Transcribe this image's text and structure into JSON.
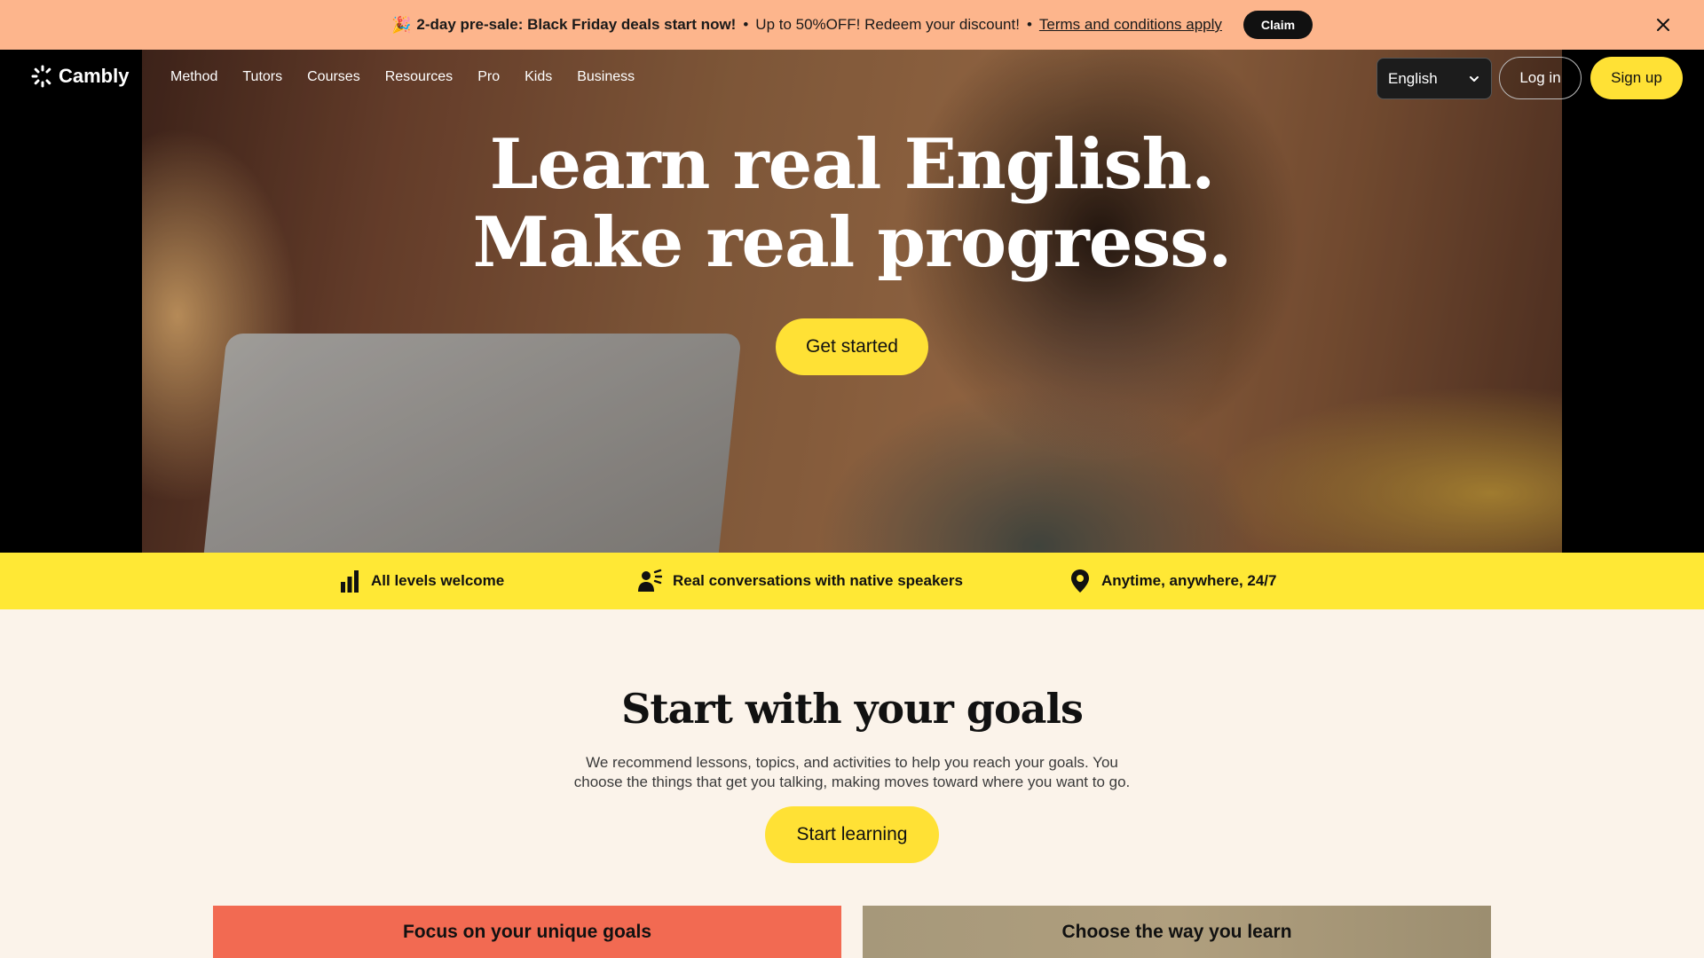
{
  "promo": {
    "emoji": "🎉",
    "headline": "2-day pre-sale: Black Friday deals start now!",
    "separator": "•",
    "offer": "Up to 50%OFF! Redeem your discount!",
    "terms_link": "Terms and conditions apply",
    "claim_label": "Claim",
    "close_icon": "close-icon"
  },
  "nav": {
    "logo_text": "Cambly",
    "links": [
      "Method",
      "Tutors",
      "Courses",
      "Resources",
      "Pro",
      "Kids",
      "Business"
    ],
    "language_selected": "English",
    "login_label": "Log in",
    "signup_label": "Sign up"
  },
  "hero": {
    "title_line1": "Learn real English.",
    "title_line2": "Make real progress.",
    "cta_label": "Get started"
  },
  "features": [
    {
      "icon": "bar-chart-icon",
      "label": "All levels welcome"
    },
    {
      "icon": "speaking-person-icon",
      "label": "Real conversations with native speakers"
    },
    {
      "icon": "location-pin-icon",
      "label": "Anytime, anywhere, 24/7"
    }
  ],
  "goals": {
    "title": "Start with your goals",
    "description_line1": "We recommend lessons, topics, and activities to help you reach your goals. You",
    "description_line2": "choose the things that get you talking, making moves toward where you want to go.",
    "cta_label": "Start learning"
  },
  "cards": [
    {
      "label": "Focus on your unique goals"
    },
    {
      "label": "Choose the way you learn"
    }
  ],
  "colors": {
    "promo_bg": "#fdb58c",
    "accent_yellow": "#ffe135",
    "features_bg": "#ffe835",
    "page_bg": "#fbf3ea",
    "card_coral": "#f26a52",
    "card_tan": "#a6987a"
  }
}
